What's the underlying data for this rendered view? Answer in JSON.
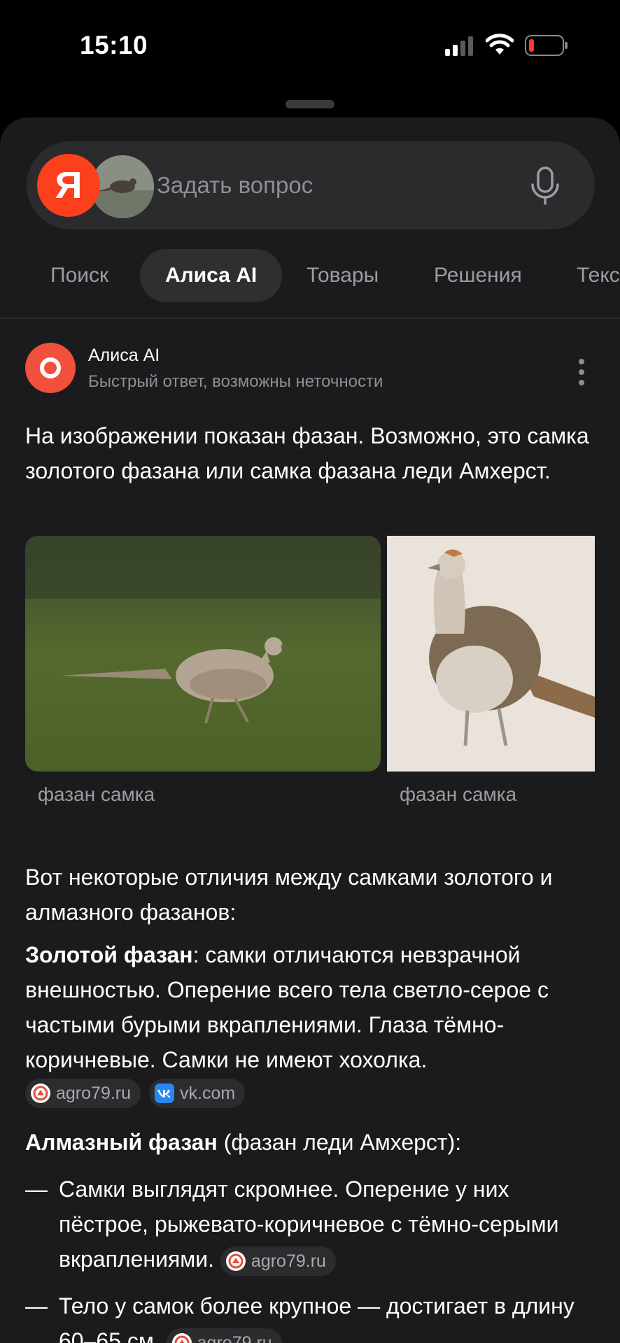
{
  "status_bar": {
    "time": "15:10"
  },
  "search": {
    "logo_letter": "Я",
    "placeholder": "Задать вопрос"
  },
  "tabs": [
    {
      "label": "Поиск"
    },
    {
      "label": "Алиса AI",
      "active": true
    },
    {
      "label": "Товары"
    },
    {
      "label": "Решения"
    },
    {
      "label": "Текс"
    }
  ],
  "answer": {
    "source_name": "Алиса AI",
    "source_subtitle": "Быстрый ответ, возможны неточности",
    "intro": "На изображении показан фазан. Возможно, это самка золотого фазана или самка фазана леди Амхерст.",
    "images": [
      {
        "caption": "фазан самка"
      },
      {
        "caption": "фазан самка"
      }
    ],
    "lead": "Вот некоторые отличия между самками золотого и алмазного фазанов:",
    "golden": {
      "title": "Золотой фазан",
      "text": ": самки отличаются невзрачной внешностью. Оперение всего тела светло-серое с частыми бурыми вкраплениями. Глаза тёмно-коричневые. Самки не имеют хохолка.",
      "sources": [
        "agro79.ru",
        "vk.com"
      ]
    },
    "diamond": {
      "title": "Алмазный фазан",
      "text": " (фазан леди Амхерст):",
      "items": [
        {
          "text": "Самки выглядят скромнее. Оперение у них пёстрое, рыжевато-коричневое с тёмно-серыми вкраплениями.",
          "source": "agro79.ru"
        },
        {
          "text": "Тело у самок более крупное — достигает в длину 60–65 см.",
          "source": "agro79.ru"
        }
      ]
    }
  }
}
